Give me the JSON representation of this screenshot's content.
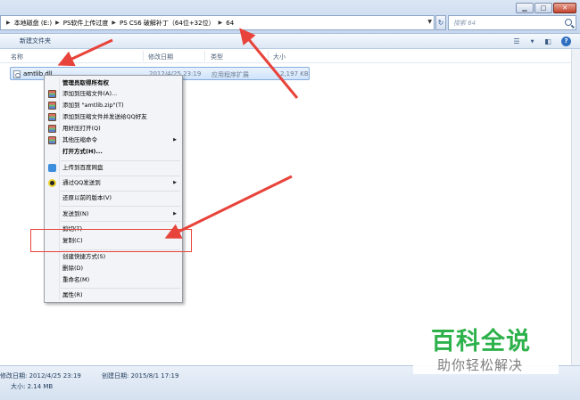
{
  "breadcrumb": [
    "本地磁盘 (E:)",
    "PS软件上传过度",
    "PS CS6 破解补丁（64位+32位）",
    "64"
  ],
  "search": {
    "placeholder": "搜索 64"
  },
  "toolbar": {
    "new_folder": "新建文件夹"
  },
  "columns": {
    "name": "名称",
    "modified": "修改日期",
    "type": "类型",
    "size": "大小"
  },
  "file": {
    "name": "amtlib.dll",
    "modified": "2012/4/25 23:19",
    "type": "应用程序扩展",
    "size": "2,197 KB"
  },
  "context_menu": {
    "admin": "管理员取得所有权",
    "add_archive": "添加到压缩文件(A)...",
    "add_zip": "添加到 \"amtlib.zip\"(T)",
    "compress_qq": "添加到压缩文件并发送给QQ好友",
    "open_with_haozip": "用好压打开(Q)",
    "other_compress": "其他压缩命令",
    "open_with": "打开方式(H)...",
    "upload_baidu": "上传到百度网盘",
    "send_qq": "通过QQ发送到",
    "restore": "还原以前的版本(V)",
    "send_to": "发送到(N)",
    "cut": "剪切(T)",
    "copy": "复制(C)",
    "shortcut": "创建快捷方式(S)",
    "delete": "删除(D)",
    "rename": "重命名(M)",
    "properties": "属性(R)"
  },
  "details": {
    "modified": "修改日期: 2012/4/25 23:19",
    "created": "创建日期: 2015/8/1 17:19",
    "size": "大小: 2.14 MB"
  },
  "watermark": {
    "title": "百科全说",
    "subtitle": "助你轻松解决"
  },
  "colors": {
    "accent": "#2db14a",
    "arrow": "#e8433a",
    "selection": "#cfe3fb"
  }
}
